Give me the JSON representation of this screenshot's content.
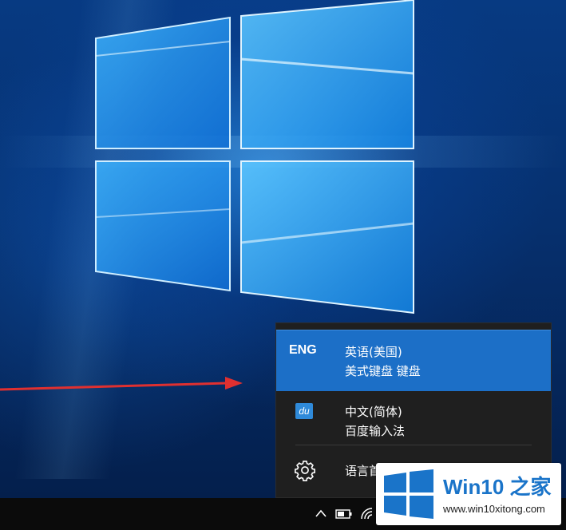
{
  "language_flyout": {
    "items": [
      {
        "code": "ENG",
        "name": "英语(美国)",
        "keyboard": "美式键盘 键盘",
        "selected": true
      },
      {
        "icon": "baidu-ime-icon",
        "icon_text": "du",
        "name": "中文(简体)",
        "keyboard": "百度输入法",
        "selected": false
      }
    ],
    "preferences_label": "语言首选项",
    "preferences_icon": "gear-icon"
  },
  "taskbar": {
    "tray_icons": [
      "chevron-up-icon",
      "battery-icon",
      "wifi-icon"
    ]
  },
  "watermark": {
    "title": "Win10 之家",
    "url": "www.win10xitong.com",
    "logo_color": "#1a74c9"
  },
  "colors": {
    "accent": "#1c6fc7",
    "arrow": "#e03030",
    "flyout_bg": "#1f1f1f",
    "taskbar_bg": "#0b0b0b"
  }
}
